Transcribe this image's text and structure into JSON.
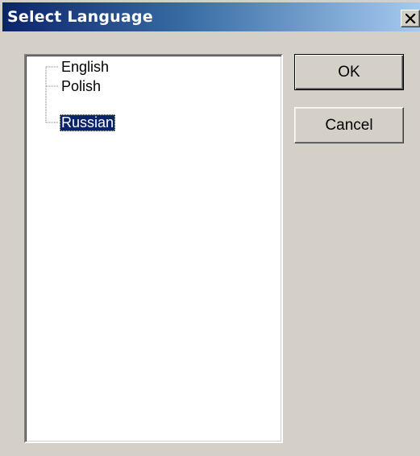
{
  "dialog": {
    "title": "Select Language",
    "close_icon": "close-icon"
  },
  "tree": {
    "items": [
      {
        "label": "English",
        "selected": false
      },
      {
        "label": "Polish",
        "selected": false
      },
      {
        "label": "Russian",
        "selected": true
      }
    ]
  },
  "buttons": {
    "ok_label": "OK",
    "cancel_label": "Cancel"
  },
  "colors": {
    "face": "#d4d0c8",
    "title_start": "#0a246a",
    "title_end": "#a6caf0",
    "selection": "#0a246a"
  }
}
